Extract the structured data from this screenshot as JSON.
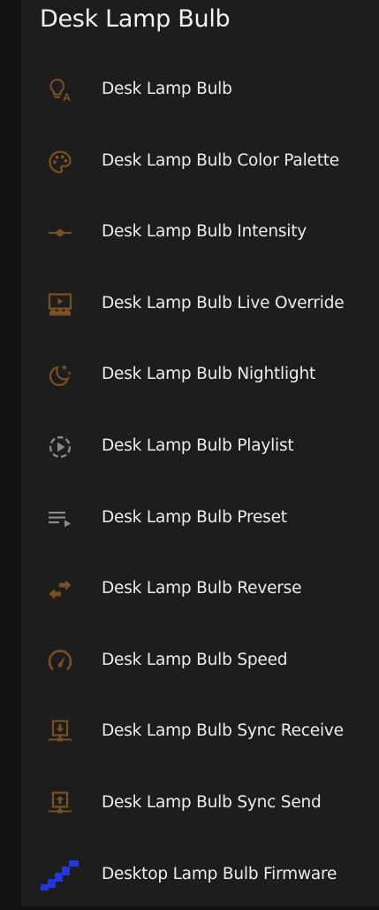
{
  "page": {
    "title": "Desk Lamp Bulb"
  },
  "colors": {
    "icon_brown": "#7a5020",
    "icon_gray": "#8a8a8a",
    "firmware_blue": "#1f36e0",
    "text": "#ececec",
    "panel_bg": "#1d1d1d"
  },
  "entities": [
    {
      "label": "Desk Lamp Bulb",
      "icon": "lightbulb-auto-icon"
    },
    {
      "label": "Desk Lamp Bulb Color Palette",
      "icon": "palette-icon"
    },
    {
      "label": "Desk Lamp Bulb Intensity",
      "icon": "slider-icon"
    },
    {
      "label": "Desk Lamp Bulb Live Override",
      "icon": "theater-icon"
    },
    {
      "label": "Desk Lamp Bulb Nightlight",
      "icon": "moon-stars-icon"
    },
    {
      "label": "Desk Lamp Bulb Playlist",
      "icon": "play-circle-dashed-icon"
    },
    {
      "label": "Desk Lamp Bulb Preset",
      "icon": "playlist-play-icon"
    },
    {
      "label": "Desk Lamp Bulb Reverse",
      "icon": "swap-arrows-icon"
    },
    {
      "label": "Desk Lamp Bulb Speed",
      "icon": "speedometer-icon"
    },
    {
      "label": "Desk Lamp Bulb Sync Receive",
      "icon": "download-network-icon"
    },
    {
      "label": "Desk Lamp Bulb Sync Send",
      "icon": "upload-network-icon"
    },
    {
      "label": "Desktop Lamp Bulb Firmware",
      "icon": "firmware-stairs-icon"
    }
  ]
}
